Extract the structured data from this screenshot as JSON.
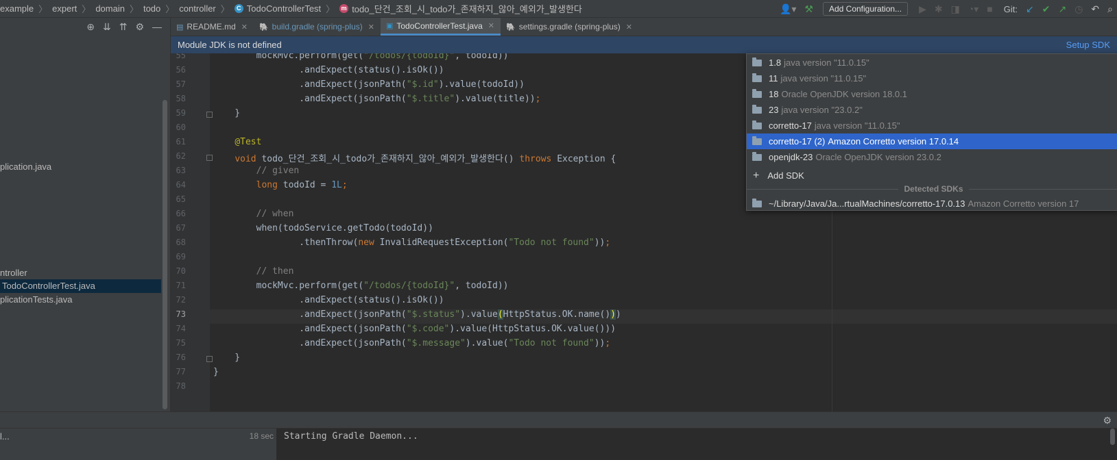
{
  "breadcrumb": {
    "items": [
      "example",
      "expert",
      "domain",
      "todo",
      "controller",
      "TodoControllerTest",
      "todo_단건_조회_시_todo가_존재하지_않아_예외가_발생한다"
    ]
  },
  "toolbar": {
    "add_configuration": "Add Configuration...",
    "git_label": "Git:"
  },
  "project_tree": [
    {
      "label": "plication.java",
      "selected": false
    },
    {
      "label": "ntroller",
      "selected": false
    },
    {
      "label": "TodoControllerTest.java",
      "selected": true
    },
    {
      "label": "plicationTests.java",
      "selected": false
    }
  ],
  "tabs": [
    {
      "label": "README.md",
      "active": false,
      "gradle": false
    },
    {
      "label": "build.gradle (spring-plus)",
      "active": false,
      "gradle": true
    },
    {
      "label": "TodoControllerTest.java",
      "active": true,
      "gradle": false
    },
    {
      "label": "settings.gradle (spring-plus)",
      "active": false,
      "gradle": false
    }
  ],
  "notification": {
    "message": "Module JDK is not defined",
    "action": "Setup SDK"
  },
  "editor": {
    "current_line": "73",
    "lines": [
      {
        "n": "55",
        "html": "        mockMvc.perform(get(<span class=\"str\">\"/todos/{todoId}\"</span>, todoId))"
      },
      {
        "n": "56",
        "html": "                .andExpect(status().isOk())"
      },
      {
        "n": "57",
        "html": "                .andExpect(jsonPath(<span class=\"str\">\"$.id\"</span>).value(todoId))"
      },
      {
        "n": "58",
        "html": "                .andExpect(jsonPath(<span class=\"str\">\"$.title\"</span>).value(title))<span class=\"kw\">;</span>"
      },
      {
        "n": "59",
        "html": "    }"
      },
      {
        "n": "60",
        "html": ""
      },
      {
        "n": "61",
        "html": "    <span class=\"ann\">@Test</span>"
      },
      {
        "n": "62",
        "html": "    <span class=\"kw\">void</span> todo_단건_조회_시_todo가_존재하지_않아_예외가_발생한다() <span class=\"kw\">throws</span> Exception {"
      },
      {
        "n": "63",
        "html": "        <span class=\"cmt\">// given</span>"
      },
      {
        "n": "64",
        "html": "        <span class=\"kw\">long</span> todoId = <span class=\"num\">1L</span><span class=\"kw\">;</span>"
      },
      {
        "n": "65",
        "html": ""
      },
      {
        "n": "66",
        "html": "        <span class=\"cmt\">// when</span>"
      },
      {
        "n": "67",
        "html": "        when(todoService.getTodo(todoId))"
      },
      {
        "n": "68",
        "html": "                .thenThrow(<span class=\"kw\">new</span> InvalidRequestException(<span class=\"str\">\"Todo not found\"</span>))<span class=\"kw\">;</span>"
      },
      {
        "n": "69",
        "html": ""
      },
      {
        "n": "70",
        "html": "        <span class=\"cmt\">// then</span>"
      },
      {
        "n": "71",
        "html": "        mockMvc.perform(get(<span class=\"str\">\"/todos/{todoId}\"</span>, todoId))"
      },
      {
        "n": "72",
        "html": "                .andExpect(status().isOk())"
      },
      {
        "n": "73",
        "html": "                .andExpect(jsonPath(<span class=\"str\">\"$.status\"</span>).value<span class=\"brace-hl\">(</span>HttpStatus.OK.name()<span class=\"brace-hl\">)</span>)"
      },
      {
        "n": "74",
        "html": "                .andExpect(jsonPath(<span class=\"str\">\"$.code\"</span>).value(HttpStatus.OK.value()))"
      },
      {
        "n": "75",
        "html": "                .andExpect(jsonPath(<span class=\"str\">\"$.message\"</span>).value(<span class=\"str\">\"Todo not found\"</span>))<span class=\"kw\">;</span>"
      },
      {
        "n": "76",
        "html": "    }"
      },
      {
        "n": "77",
        "html": "}"
      },
      {
        "n": "78",
        "html": ""
      }
    ]
  },
  "sdk_popup": {
    "items": [
      {
        "name": "1.8",
        "version": "java version \"11.0.15\"",
        "selected": false
      },
      {
        "name": "11",
        "version": "java version \"11.0.15\"",
        "selected": false
      },
      {
        "name": "18",
        "version": "Oracle OpenJDK version 18.0.1",
        "selected": false
      },
      {
        "name": "23",
        "version": "java version \"23.0.2\"",
        "selected": false
      },
      {
        "name": "corretto-17",
        "version": "java version \"11.0.15\"",
        "selected": false
      },
      {
        "name": "corretto-17 (2)",
        "version": "Amazon Corretto version 17.0.14",
        "selected": true
      },
      {
        "name": "openjdk-23",
        "version": "Oracle OpenJDK version 23.0.2",
        "selected": false
      }
    ],
    "add_sdk": "Add SDK",
    "detected_header": "Detected SDKs",
    "detected": [
      {
        "name": "~/Library/Java/Ja...rtualMachines/corretto-17.0.13",
        "version": "Amazon Corretto version 17"
      }
    ]
  },
  "bottom_panel": {
    "run_item": "l...",
    "run_time": "18 sec",
    "console_line": "Starting Gradle Daemon..."
  }
}
